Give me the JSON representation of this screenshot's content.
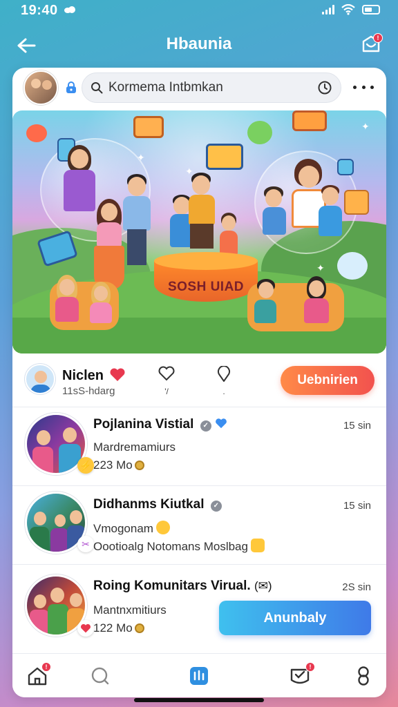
{
  "status_bar": {
    "time": "19:40"
  },
  "header": {
    "title": "Hbaunia",
    "notification_badge": "!"
  },
  "search": {
    "text": "Kormema Intbmkan"
  },
  "hero": {
    "pedestal_label": "SOSH UIAD"
  },
  "owner": {
    "name": "Niclen",
    "subtitle": "11sS-hdarg",
    "reaction_counts": [
      "",
      "'/",
      "."
    ],
    "join_label": "Uebnirien"
  },
  "items": [
    {
      "title": "Pojlanina Vistial",
      "line1": "Mardremamiurs",
      "line2": "223 Mo",
      "time": "15 sin"
    },
    {
      "title": "Didhanms Kiutkal",
      "line1": "Vmogonam",
      "line2": "Oootioalg Notomans Moslbag",
      "time": "15 sin"
    },
    {
      "title": "Roing Komunitars Virual.",
      "title_suffix": "(✉)",
      "line1": "Mantnxmitiurs",
      "line2": "122 Mo",
      "time": "2S sin",
      "button_label": "Anunbaly"
    }
  ],
  "tabs": [
    {
      "name": "home",
      "badge": "!"
    },
    {
      "name": "search"
    },
    {
      "name": "create"
    },
    {
      "name": "inbox",
      "badge": "!"
    },
    {
      "name": "profile"
    }
  ],
  "colors": {
    "join_gradient": [
      "#ff8a48",
      "#f2524e"
    ],
    "view_gradient": [
      "#3fc0ee",
      "#3f7ae8"
    ],
    "badge_red": "#e8384f",
    "verified_blue": "#3a8ef0"
  },
  "icons": [
    "signal-icon",
    "wifi-icon",
    "battery-icon",
    "back-arrow-icon",
    "notification-icon",
    "lock-icon",
    "search-icon",
    "refresh-icon",
    "more-icon",
    "heart-icon",
    "heart-outline-icon",
    "pin-icon",
    "verified-icon",
    "home-icon",
    "search-tab-icon",
    "create-icon",
    "inbox-icon",
    "profile-icon"
  ]
}
